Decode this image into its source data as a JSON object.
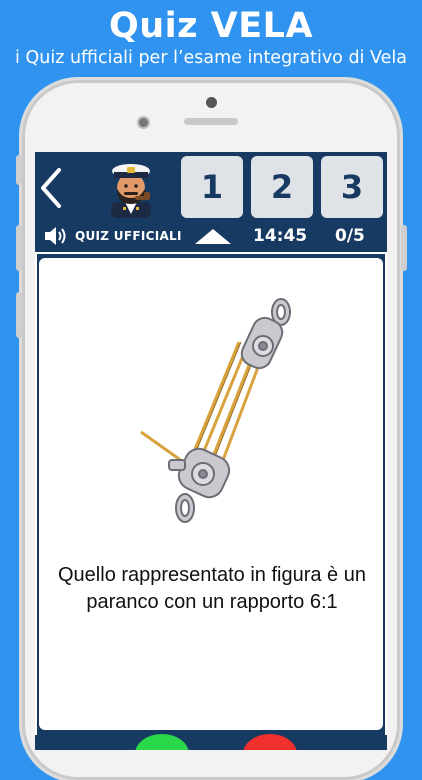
{
  "promo": {
    "title": "Quiz VELA",
    "subtitle": "i Quiz ufficiali per l’esame integrativo di Vela"
  },
  "topbar": {
    "back_icon": "chevron-left-icon",
    "avatar_icon": "captain-avatar-icon",
    "answer_buttons": [
      "1",
      "2",
      "3"
    ],
    "mode_label": "QUIZ UFFICIALI",
    "timer": "14:45",
    "progress": "0/5"
  },
  "question": {
    "image_icon": "pulley-block-icon",
    "text": "Quello rappresentato in figura è un paranco con un rapporto 6:1"
  },
  "actions": {
    "true_color": "#2bd84a",
    "false_color": "#f0302c"
  },
  "colors": {
    "background": "#2f93ef",
    "navbar": "#173a62"
  }
}
